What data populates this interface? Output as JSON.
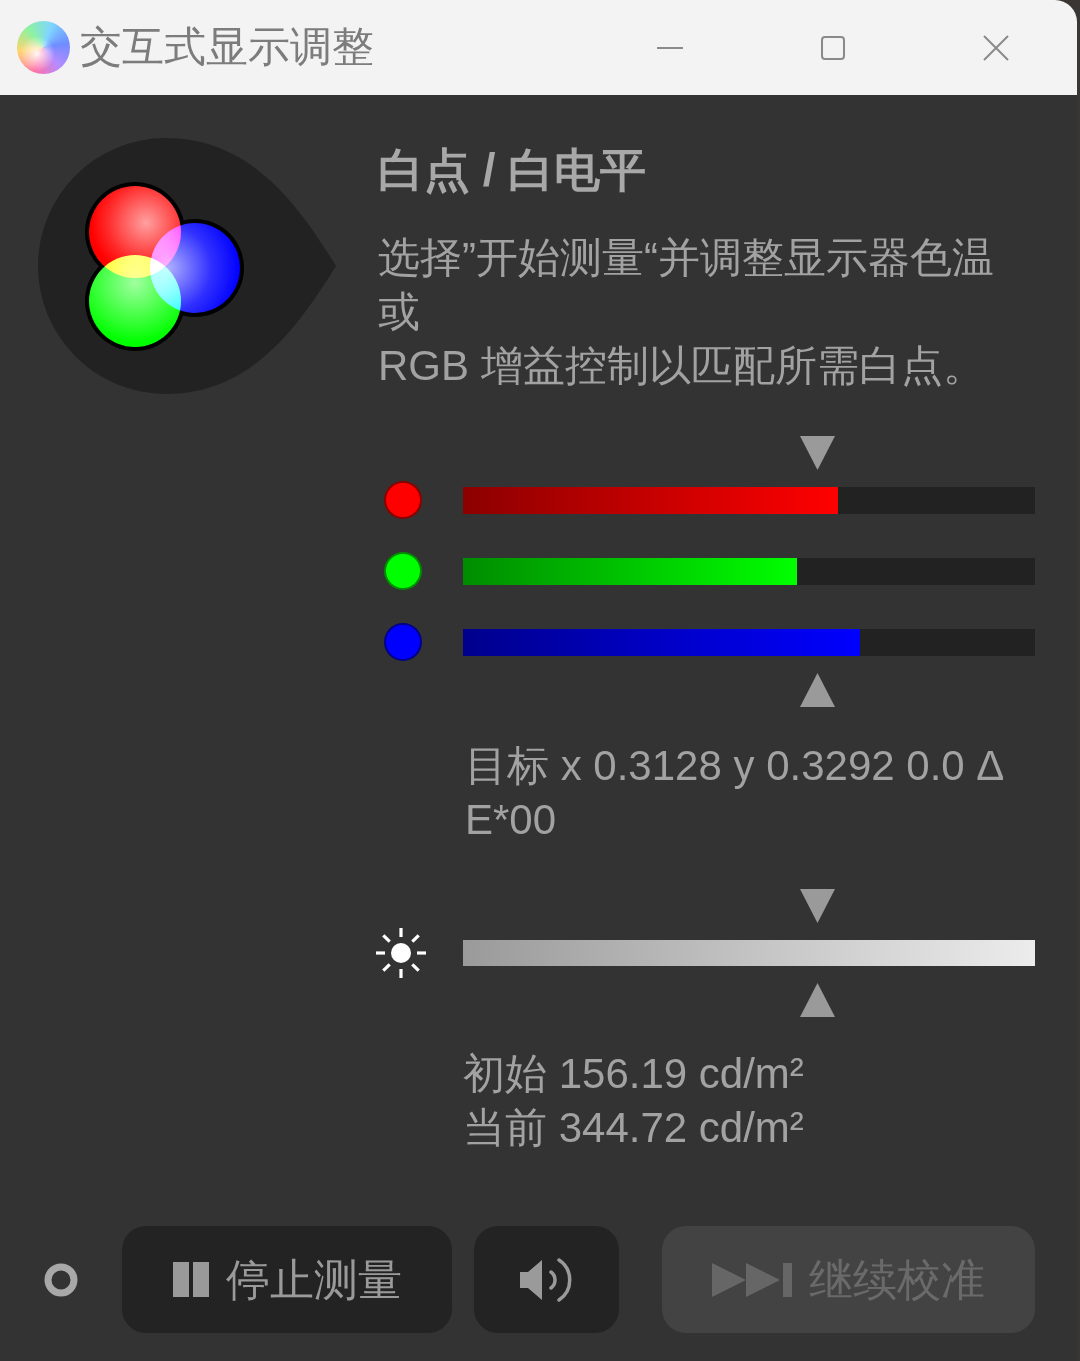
{
  "window": {
    "title": "交互式显示调整"
  },
  "heading": "白点 / 白电平",
  "description_lines": [
    "选择”开始测量“并调整显示器色温",
    "或",
    "RGB 增益控制以匹配所需白点。"
  ],
  "rgb_gain": {
    "channels": [
      {
        "color": "#ff0000",
        "level": 0.656
      },
      {
        "color": "#00ff00",
        "level": 0.584
      },
      {
        "color": "#0000ff",
        "level": 0.694
      }
    ]
  },
  "target_lines": [
    "目标 x 0.3128 y 0.3292 0.0 Δ",
    "E*00"
  ],
  "brightness": {
    "level": 1
  },
  "luminance_lines": [
    "初始 156.19 cd/m²",
    "当前 344.72 cd/m²"
  ],
  "buttons": [
    {
      "kind": "stop",
      "label": "停止测量",
      "disabled": false
    },
    {
      "kind": "sound",
      "disabled": false
    },
    {
      "kind": "continue",
      "label": "继续校准",
      "disabled": true
    }
  ]
}
